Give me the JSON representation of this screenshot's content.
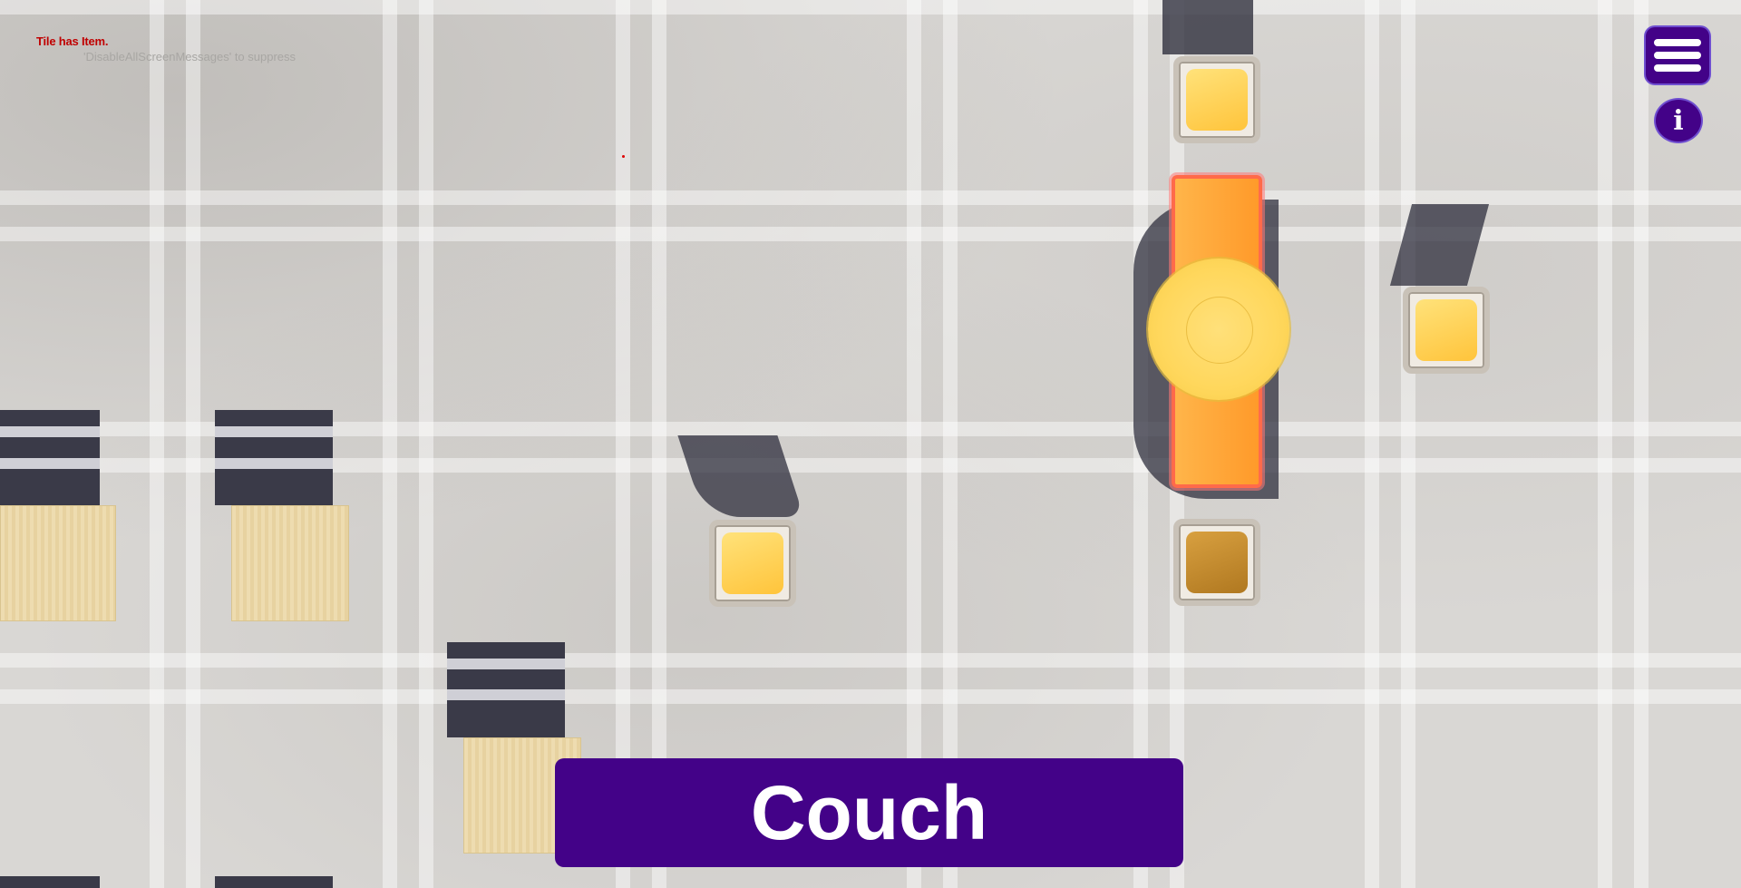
{
  "debug": {
    "message": "Tile has Item.",
    "hint": "'DisableAllScreenMessages' to suppress"
  },
  "hud": {
    "menu_icon": "hamburger-menu-icon",
    "info_icon": "info-icon",
    "info_glyph": "i",
    "accent_color": "#430288"
  },
  "selected_item": {
    "name": "Couch"
  },
  "scene_objects": [
    {
      "type": "crate"
    },
    {
      "type": "crate"
    },
    {
      "type": "crate"
    },
    {
      "type": "chair"
    },
    {
      "type": "chair"
    },
    {
      "type": "chair"
    },
    {
      "type": "chair"
    },
    {
      "type": "couch",
      "selected": true
    },
    {
      "type": "round-table"
    }
  ]
}
